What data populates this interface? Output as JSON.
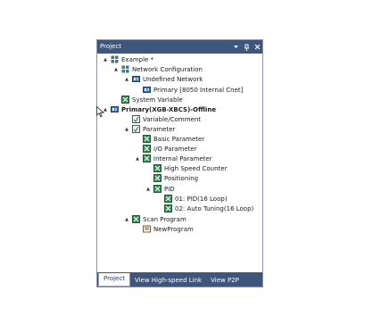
{
  "panel": {
    "title": "Project",
    "controls": {
      "dropdown": "▾",
      "pin": "ᵠ",
      "close": "✕"
    }
  },
  "tree": [
    {
      "label": "Example *",
      "icon": "project-icon",
      "expander": "▲",
      "bold": false
    },
    {
      "label": "Network Configuration",
      "icon": "network-config-icon",
      "expander": "▲",
      "bold": false
    },
    {
      "label": "Undefined Network",
      "icon": "network-icon",
      "expander": "▲",
      "bold": false
    },
    {
      "label": "Primary [8050 Internal Cnet]",
      "icon": "station-icon",
      "expander": "",
      "bold": false
    },
    {
      "label": "System Variable",
      "icon": "system-variable-icon",
      "expander": "",
      "bold": false
    },
    {
      "label": "Primary(XGB-XBCS)-Offline",
      "icon": "plc-icon",
      "expander": "▲",
      "bold": true
    },
    {
      "label": "Variable/Comment",
      "icon": "variable-comment-icon",
      "expander": "",
      "bold": false
    },
    {
      "label": "Parameter",
      "icon": "parameter-icon",
      "expander": "▲",
      "bold": false
    },
    {
      "label": "Basic Parameter",
      "icon": "basic-parameter-icon",
      "expander": "",
      "bold": false
    },
    {
      "label": "I/O Parameter",
      "icon": "io-parameter-icon",
      "expander": "",
      "bold": false
    },
    {
      "label": "Internal Parameter",
      "icon": "internal-parameter-icon",
      "expander": "▲",
      "bold": false
    },
    {
      "label": "High Speed Counter",
      "icon": "high-speed-counter-icon",
      "expander": "",
      "bold": false
    },
    {
      "label": "Positioning",
      "icon": "positioning-icon",
      "expander": "",
      "bold": false
    },
    {
      "label": "PID",
      "icon": "pid-icon",
      "expander": "▲",
      "bold": false
    },
    {
      "label": "01: PID(16 Loop)",
      "icon": "pid-loop-icon",
      "expander": "",
      "bold": false
    },
    {
      "label": "02: Auto Tuning(16 Loop)",
      "icon": "auto-tuning-icon",
      "expander": "",
      "bold": false
    },
    {
      "label": "Scan Program",
      "icon": "scan-program-icon",
      "expander": "▲",
      "bold": false
    },
    {
      "label": "NewProgram",
      "icon": "program-icon",
      "expander": "",
      "bold": false
    }
  ],
  "tabs": [
    {
      "label": "Project",
      "active": true
    },
    {
      "label": "View High-speed Link",
      "active": false
    },
    {
      "label": "View P2P",
      "active": false
    }
  ],
  "colors": {
    "titlebar": "#3e557c",
    "tab_text_active": "#1c3d70",
    "icon_green": "#2f8a4e",
    "icon_blue": "#3e72b5"
  }
}
